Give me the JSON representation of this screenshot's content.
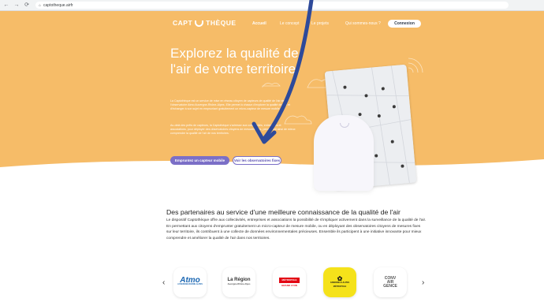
{
  "browser": {
    "url": "captotheque.airfr",
    "back": "←",
    "forward": "→",
    "reload": "⟳"
  },
  "nav": {
    "logo": "CAPT THÈQUE",
    "items": [
      "Accueil",
      "Le concept",
      "Le projets",
      "Qui sommes-nous ?"
    ],
    "connexion": "Connexion"
  },
  "hero": {
    "title": "Explorez la qualité de l'air de votre territoire",
    "paragraph1": "La Captothèque est un service de mise en réseau citoyen de capteurs de qualité de l'air de l'observatoire Atmo Auvergne-Rhône-Alpes. Elle permet à chacun d'explorer la qualité de l'air et d'échanger à son sujet en empruntant gratuitement un micro-capteur de mesure mobile.",
    "paragraph2": "Au-delà des prêts de capteurs, la Captothèque s'adresse aux collectivités, entreprises et associations, pour déployer des observatoires citoyens de mesures fixes, permettant ainsi de mieux comprendre la qualité de l'air de nos territoires.",
    "btn_primary": "Empruntez un capteur mobile",
    "btn_secondary": "Voir les observatoires fixes"
  },
  "partners_section": {
    "title": "Des partenaires au service d'une meilleure connaissance de la qualité de l'air",
    "text": "Le dispositif Captothèque offre aux collectivités, entreprises et associations la possibilité de s'impliquer activement dans la surveillance de la qualité de l'air. En permettant aux citoyens d'emprunter gratuitement un micro-capteur de mesure mobile, ou en déployant des observatoires citoyens de mesures fixes sur leur territoire, ils contribuent à une collecte de données environnementales précieuses. Ensemble ils participent à une initiative innovante pour mieux comprendre et améliorer la qualité de l'air dans nos territoires.",
    "prev": "‹",
    "next": "›",
    "logos": [
      {
        "name": "Atmo",
        "sub": "AUVERGNE-RHÔNE-ALPES",
        "color": "#1a66b2"
      },
      {
        "name": "La Région",
        "sub": "Auvergne-Rhône-Alpes",
        "color": "#333333"
      },
      {
        "name": "MÉTROPOLE",
        "sub": "GRAND LYON",
        "color": "#e30613"
      },
      {
        "name": "GRENOBLE-ALPES",
        "sub": "MÉTROPOLE",
        "color": "#1a1a1a"
      },
      {
        "name": "CONV AIR GENCE",
        "sub": "",
        "color": "#555555"
      }
    ]
  },
  "colors": {
    "hero_bg": "#f6bc68",
    "accent": "#7b6fc7",
    "arrow": "#2e4a9a"
  }
}
